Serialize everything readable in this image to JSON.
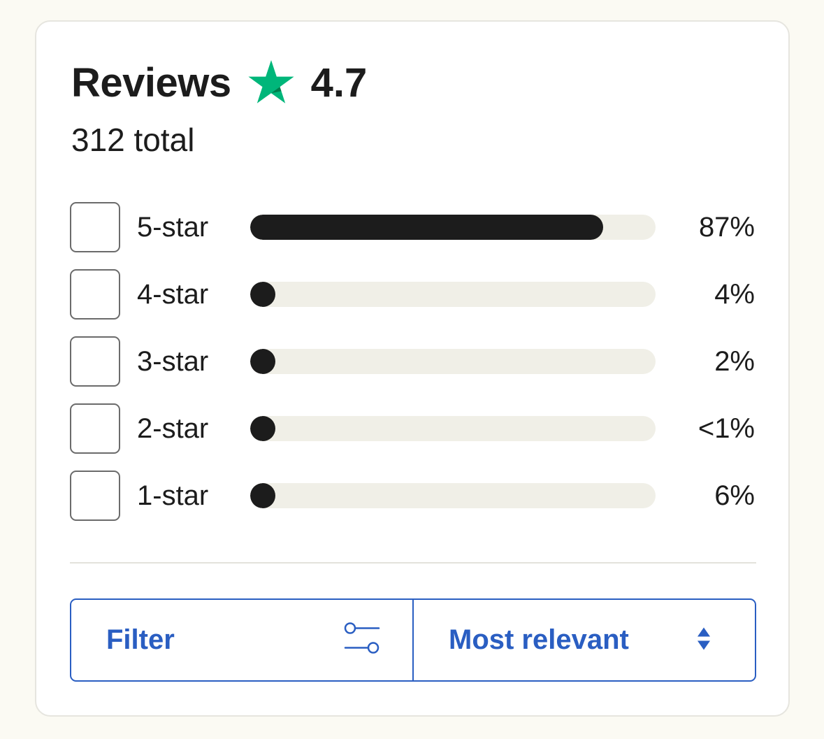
{
  "reviews": {
    "title": "Reviews",
    "rating": "4.7",
    "total": "312 total",
    "accent_color": "#00b67a",
    "icon": "star-icon"
  },
  "breakdown": [
    {
      "label": "5-star",
      "percent_text": "87%",
      "fraction": 0.87
    },
    {
      "label": "4-star",
      "percent_text": "4%",
      "fraction": 0.04
    },
    {
      "label": "3-star",
      "percent_text": "2%",
      "fraction": 0.02
    },
    {
      "label": "2-star",
      "percent_text": "<1%",
      "fraction": 0.005
    },
    {
      "label": "1-star",
      "percent_text": "6%",
      "fraction": 0.06
    }
  ],
  "controls": {
    "filter_label": "Filter",
    "filter_icon": "sliders-icon",
    "sort_label": "Most relevant",
    "sort_icon": "sort-arrows-icon",
    "link_color": "#2a5ec2"
  }
}
